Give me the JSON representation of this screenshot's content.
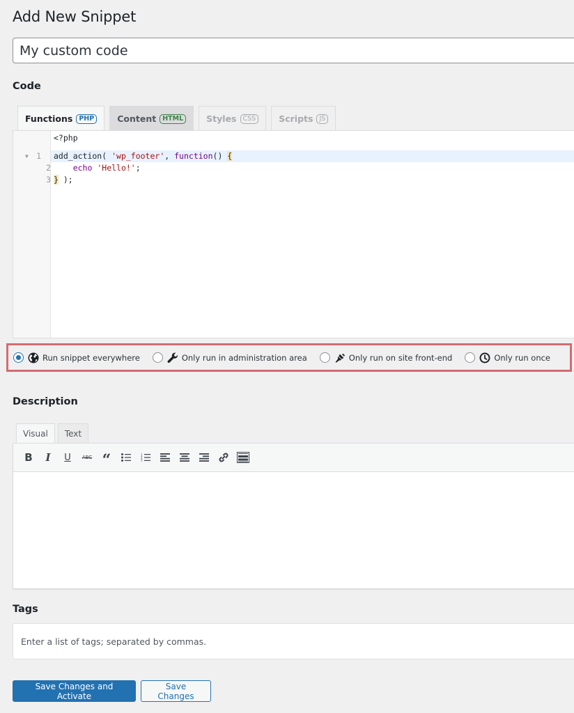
{
  "page": {
    "title": "Add New Snippet",
    "snippet_name": "My custom code"
  },
  "code_section": {
    "heading": "Code",
    "tabs": [
      {
        "label": "Functions",
        "badge": "PHP",
        "active": true
      },
      {
        "label": "Content",
        "badge": "HTML",
        "active": false
      },
      {
        "label": "Styles",
        "badge": "CSS",
        "active": false
      },
      {
        "label": "Scripts",
        "badge": "JS",
        "active": false
      }
    ],
    "editor": {
      "prefix": "<?php",
      "lines": [
        {
          "number": "1",
          "text": "add_action( 'wp_footer', function() {"
        },
        {
          "number": "2",
          "text": "    echo 'Hello!';"
        },
        {
          "number": "3",
          "text": "} );"
        }
      ],
      "line1": {
        "a": "add_action( ",
        "str": "'wp_footer'",
        "b": ", ",
        "kw": "function",
        "c": "() ",
        "br": "{"
      },
      "line2": {
        "indent": "    ",
        "kw": "echo",
        "sp": " ",
        "str": "'Hello!'",
        "end": ";"
      },
      "line3": {
        "br": "}",
        "end": " );"
      }
    }
  },
  "scope": {
    "selected": "global",
    "options": [
      {
        "value": "global",
        "icon": "globe-icon",
        "label": "Run snippet everywhere"
      },
      {
        "value": "admin",
        "icon": "wrench-icon",
        "label": "Only run in administration area"
      },
      {
        "value": "front-end",
        "icon": "paintbrush-icon",
        "label": "Only run on site front-end"
      },
      {
        "value": "single-use",
        "icon": "clock-icon",
        "label": "Only run once"
      }
    ]
  },
  "description": {
    "heading": "Description",
    "tabs": [
      {
        "label": "Visual",
        "active": true
      },
      {
        "label": "Text",
        "active": false
      }
    ],
    "toolbar": [
      {
        "name": "bold",
        "icon": "bold-icon",
        "glyph": "B"
      },
      {
        "name": "italic",
        "icon": "italic-icon",
        "glyph": "I"
      },
      {
        "name": "underline",
        "icon": "underline-icon",
        "glyph": "U"
      },
      {
        "name": "strikethrough",
        "icon": "strikethrough-icon",
        "glyph": "ABC"
      },
      {
        "name": "blockquote",
        "icon": "quote-icon",
        "glyph": "“"
      },
      {
        "name": "bullet-list",
        "icon": "bullet-list-icon",
        "glyph": ""
      },
      {
        "name": "numbered-list",
        "icon": "numbered-list-icon",
        "glyph": ""
      },
      {
        "name": "align-left",
        "icon": "align-left-icon",
        "glyph": ""
      },
      {
        "name": "align-center",
        "icon": "align-center-icon",
        "glyph": ""
      },
      {
        "name": "align-right",
        "icon": "align-right-icon",
        "glyph": ""
      },
      {
        "name": "link",
        "icon": "link-icon",
        "glyph": ""
      },
      {
        "name": "toolbar-toggle",
        "icon": "keyboard-icon",
        "glyph": ""
      }
    ]
  },
  "tags": {
    "heading": "Tags",
    "placeholder": "Enter a list of tags; separated by commas.",
    "value": ""
  },
  "actions": {
    "save_activate": "Save Changes and Activate",
    "save": "Save Changes"
  },
  "colors": {
    "accent": "#2271b1",
    "highlight_border": "#d36b72",
    "background": "#f0f0f1"
  }
}
